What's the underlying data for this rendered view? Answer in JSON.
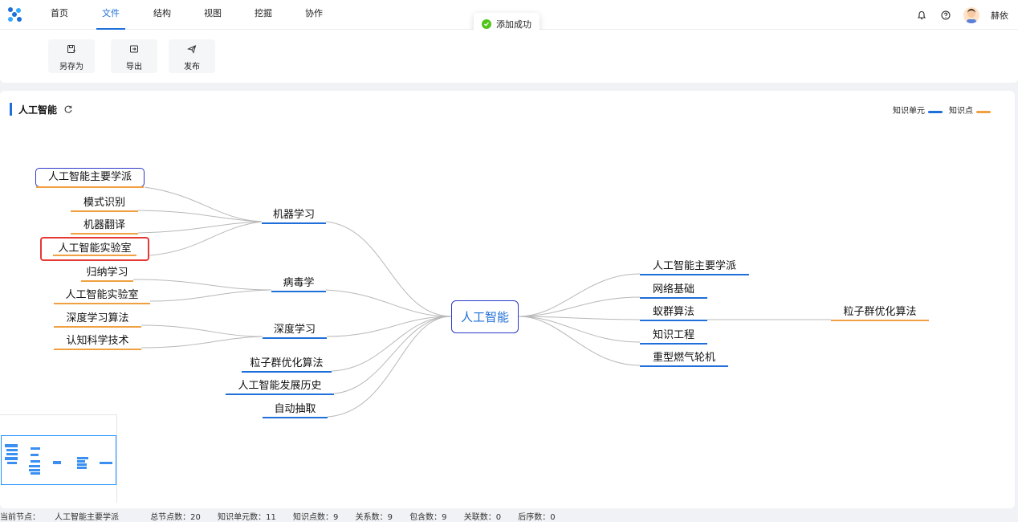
{
  "nav": {
    "tabs": [
      "首页",
      "文件",
      "结构",
      "视图",
      "挖掘",
      "协作"
    ],
    "active": "文件"
  },
  "user": {
    "name": "赫依"
  },
  "toast": {
    "text": "添加成功"
  },
  "toolbar": {
    "buttons": [
      {
        "label": "另存为",
        "icon": "save-as-icon"
      },
      {
        "label": "导出",
        "icon": "export-icon"
      },
      {
        "label": "发布",
        "icon": "publish-icon"
      }
    ]
  },
  "map": {
    "title": "人工智能",
    "legend": [
      {
        "label": "知识单元",
        "color": "#1e6fd9"
      },
      {
        "label": "知识点",
        "color": "#f0a040"
      }
    ],
    "root": "人工智能",
    "left_branches": [
      "机器学习",
      "病毒学",
      "深度学习",
      "粒子群优化算法",
      "人工智能发展历史",
      "自动抽取"
    ],
    "left_leaves": [
      "人工智能主要学派",
      "模式识别",
      "机器翻译",
      "人工智能实验室",
      "归纳学习",
      "人工智能实验室",
      "深度学习算法",
      "认知科学技术"
    ],
    "right_branches": [
      "人工智能主要学派",
      "网络基础",
      "蚁群算法",
      "知识工程",
      "重型燃气轮机"
    ],
    "right_leaves": [
      "粒子群优化算法"
    ],
    "colors": {
      "unit": "#1e6fd9",
      "point": "#f0a040",
      "selected": "#2b39c9",
      "highlight": "#e53935"
    }
  },
  "status": {
    "current_node_label": "当前节点：",
    "current_node": "人工智能主要学派",
    "total_nodes": "总节点数：20",
    "units": "知识单元数：11",
    "points": "知识点数：9",
    "relations": "关系数：9",
    "contains": "包含数：9",
    "associations": "关联数：0",
    "sequence": "后序数：0"
  }
}
